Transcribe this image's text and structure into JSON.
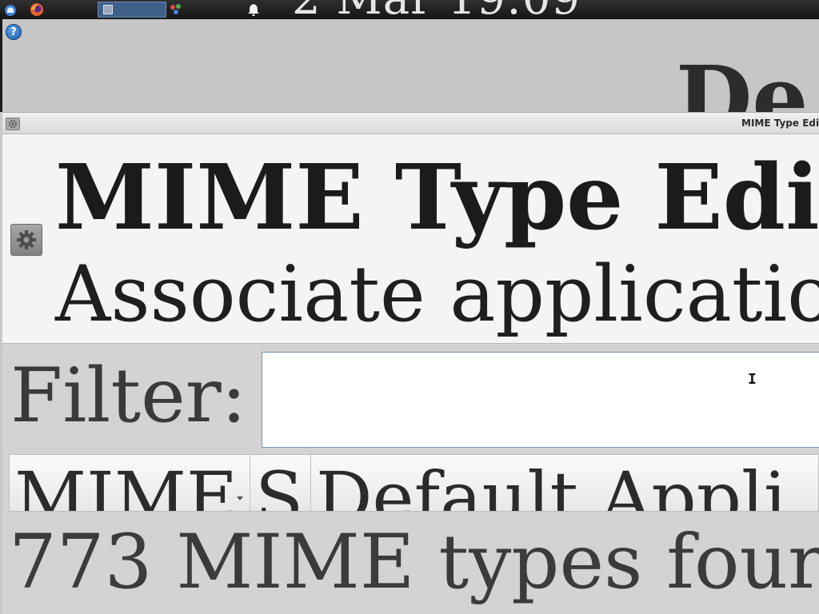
{
  "taskbar": {
    "clock": "2 Mar 19:09",
    "icons": [
      "app-menu-icon",
      "firefox-icon",
      "window-task-icon",
      "paint-icon",
      "bell-icon"
    ]
  },
  "desktop": {
    "help_icon": "?",
    "background_title": "De"
  },
  "window": {
    "title": "MIME Type Edi",
    "header_title": "MIME Type Edi",
    "header_subtitle": "Associate applicatio",
    "filter_label": "Filter:",
    "filter_value": "",
    "columns": [
      "MIME",
      "S",
      "Default Appli"
    ],
    "status": "773 MIME types four"
  },
  "colors": {
    "taskbar_bg": "#1e1e1e",
    "task_active": "#3d5f88",
    "header_bg": "#f4f4f4",
    "window_bg": "#d3d3d3",
    "input_border": "#7a90b3"
  }
}
